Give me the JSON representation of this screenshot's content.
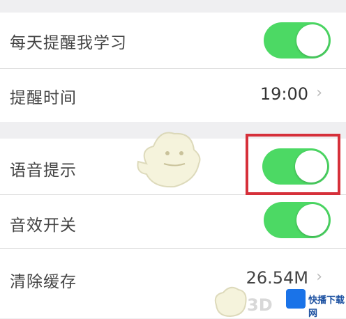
{
  "settings": {
    "daily_reminder": {
      "label": "每天提醒我学习",
      "enabled": true
    },
    "reminder_time": {
      "label": "提醒时间",
      "value": "19:00"
    },
    "voice_prompt": {
      "label": "语音提示",
      "enabled": true
    },
    "sound_effects": {
      "label": "音效开关",
      "enabled": true
    },
    "clear_cache": {
      "label": "清除缓存",
      "value": "26.54M"
    }
  },
  "chevron": "›",
  "watermark": {
    "text": "快播下载网",
    "logo": "3D"
  },
  "colors": {
    "toggle_on": "#4cd964",
    "highlight": "#d6303a",
    "background": "#efeff1"
  }
}
